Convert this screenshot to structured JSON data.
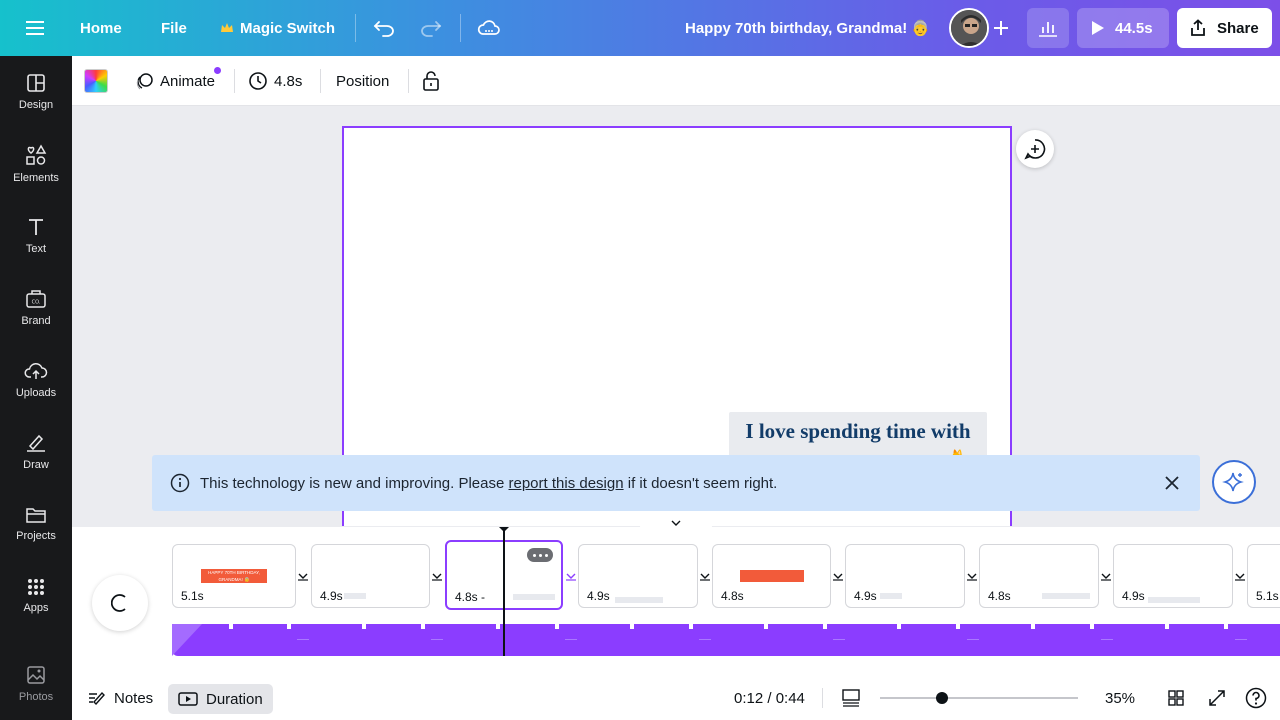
{
  "topbar": {
    "home": "Home",
    "file": "File",
    "magic_switch": "Magic Switch",
    "doc_title": "Happy 70th birthday, Grandma! 👵",
    "play_duration": "44.5s",
    "share": "Share",
    "icons": [
      "menu-icon",
      "crown-icon",
      "undo-icon",
      "redo-icon",
      "cloud-icon",
      "plus-icon",
      "analytics-icon",
      "play-icon",
      "share-icon"
    ]
  },
  "sidebar": {
    "items": [
      {
        "label": "Design",
        "icon": "design-icon"
      },
      {
        "label": "Elements",
        "icon": "elements-icon"
      },
      {
        "label": "Text",
        "icon": "text-icon"
      },
      {
        "label": "Brand",
        "icon": "brand-icon"
      },
      {
        "label": "Uploads",
        "icon": "upload-icon"
      },
      {
        "label": "Draw",
        "icon": "draw-icon"
      },
      {
        "label": "Projects",
        "icon": "folder-icon"
      },
      {
        "label": "Apps",
        "icon": "apps-icon"
      },
      {
        "label": "Photos",
        "icon": "photos-icon"
      }
    ]
  },
  "toolbar": {
    "animate": "Animate",
    "duration": "4.8s",
    "position": "Position"
  },
  "canvas": {
    "text_line1": "I love spending time with",
    "text_line2": "you 🐈"
  },
  "notice": {
    "prefix": "This technology is new and improving. Please ",
    "link": "report this design",
    "suffix": " if it doesn't seem right."
  },
  "timeline": {
    "clips": [
      {
        "duration": "5.1s",
        "mini_text": "HAPPY 70TH BIRTHDAY, GRANDMA! 👵"
      },
      {
        "duration": "4.9s"
      },
      {
        "duration": "4.8s -",
        "selected": true
      },
      {
        "duration": "4.9s"
      },
      {
        "duration": "4.8s"
      },
      {
        "duration": "4.9s"
      },
      {
        "duration": "4.8s"
      },
      {
        "duration": "4.9s"
      },
      {
        "duration": "5.1s"
      }
    ]
  },
  "footer": {
    "notes": "Notes",
    "duration": "Duration",
    "time": "0:12 / 0:44",
    "zoom": "35%",
    "zoom_level": 0.35
  },
  "colors": {
    "accent": "#8b3dff",
    "sidebar_bg": "#18191b",
    "notice_bg": "#cfe3fb",
    "mini_red": "#f25b3a",
    "canvas_text": "#123c69"
  }
}
